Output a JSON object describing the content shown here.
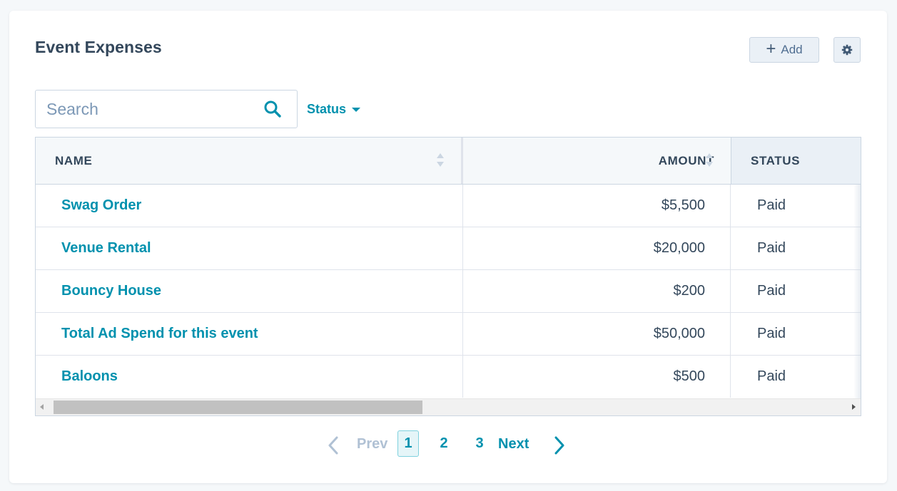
{
  "card": {
    "title": "Event Expenses"
  },
  "toolbar": {
    "add_label": "Add",
    "add_icon": "plus-icon",
    "settings_icon": "gear-icon"
  },
  "search": {
    "placeholder": "Search",
    "value": "",
    "icon": "search-icon"
  },
  "filters": {
    "status_label": "Status",
    "icon": "caret-down-icon"
  },
  "table": {
    "columns": [
      {
        "label": "NAME",
        "sortable": true
      },
      {
        "label": "AMOUNT",
        "sortable": true
      },
      {
        "label": "STATUS",
        "sortable": false
      }
    ],
    "rows": [
      {
        "name": "Swag Order",
        "amount": "$5,500",
        "status": "Paid"
      },
      {
        "name": "Venue Rental",
        "amount": "$20,000",
        "status": "Paid"
      },
      {
        "name": "Bouncy House",
        "amount": "$200",
        "status": "Paid"
      },
      {
        "name": "Total Ad Spend for this event",
        "amount": "$50,000",
        "status": "Paid"
      },
      {
        "name": "Baloons",
        "amount": "$500",
        "status": "Paid"
      }
    ]
  },
  "pagination": {
    "prev_label": "Prev",
    "next_label": "Next",
    "pages": [
      "1",
      "2",
      "3"
    ],
    "current_page": "1",
    "prev_enabled": false
  },
  "colors": {
    "accent": "#0091ae",
    "text": "#33475b",
    "border": "#cbd6e2",
    "header_bg": "#f5f8fa",
    "disabled": "#b0c1d4"
  }
}
